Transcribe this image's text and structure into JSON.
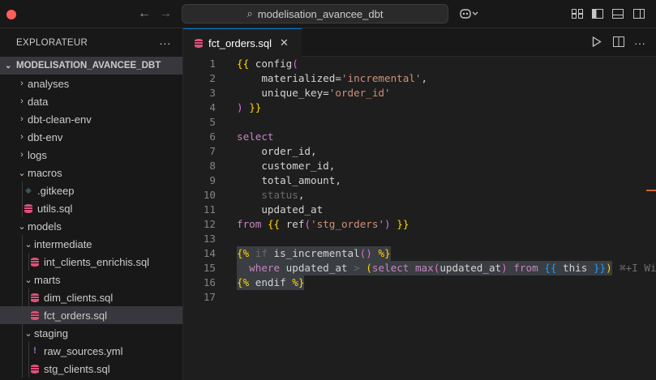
{
  "titlebar": {
    "search_text": "modelisation_avancee_dbt",
    "traffic_colors": [
      "#ff5f57",
      "#febc2e",
      "#28c840"
    ]
  },
  "sidebar": {
    "header": "EXPLORATEUR",
    "more": "···",
    "root": "MODELISATION_AVANCEE_DBT",
    "items": [
      {
        "label": "analyses",
        "type": "folder",
        "open": false,
        "depth": 1
      },
      {
        "label": "data",
        "type": "folder",
        "open": false,
        "depth": 1
      },
      {
        "label": "dbt-clean-env",
        "type": "folder",
        "open": false,
        "depth": 1
      },
      {
        "label": "dbt-env",
        "type": "folder",
        "open": false,
        "depth": 1
      },
      {
        "label": "logs",
        "type": "folder",
        "open": false,
        "depth": 1
      },
      {
        "label": "macros",
        "type": "folder",
        "open": true,
        "depth": 1
      },
      {
        "label": ".gitkeep",
        "type": "gitkeep",
        "depth": 2
      },
      {
        "label": "utils.sql",
        "type": "sql",
        "depth": 2
      },
      {
        "label": "models",
        "type": "folder",
        "open": true,
        "depth": 1
      },
      {
        "label": "intermediate",
        "type": "folder",
        "open": true,
        "depth": 2
      },
      {
        "label": "int_clients_enrichis.sql",
        "type": "sql",
        "depth": 3
      },
      {
        "label": "marts",
        "type": "folder",
        "open": true,
        "depth": 2
      },
      {
        "label": "dim_clients.sql",
        "type": "sql",
        "depth": 3
      },
      {
        "label": "fct_orders.sql",
        "type": "sql",
        "depth": 3,
        "selected": true
      },
      {
        "label": "staging",
        "type": "folder",
        "open": true,
        "depth": 2
      },
      {
        "label": "raw_sources.yml",
        "type": "yml",
        "depth": 3
      },
      {
        "label": "stg_clients.sql",
        "type": "sql",
        "depth": 3
      }
    ]
  },
  "editor": {
    "tab_label": "fct_orders.sql",
    "tab_close": "✕",
    "line_numbers": [
      "1",
      "2",
      "3",
      "4",
      "5",
      "6",
      "7",
      "8",
      "9",
      "10",
      "11",
      "12",
      "13",
      "14",
      "15",
      "16",
      "17"
    ],
    "ghost_hint": "⌘+I Wi"
  },
  "colors": {
    "accent": "#0078d4",
    "sql_icon": "#e0507a",
    "yml_icon": "#a074c4",
    "selection_bg": "#37373d"
  }
}
